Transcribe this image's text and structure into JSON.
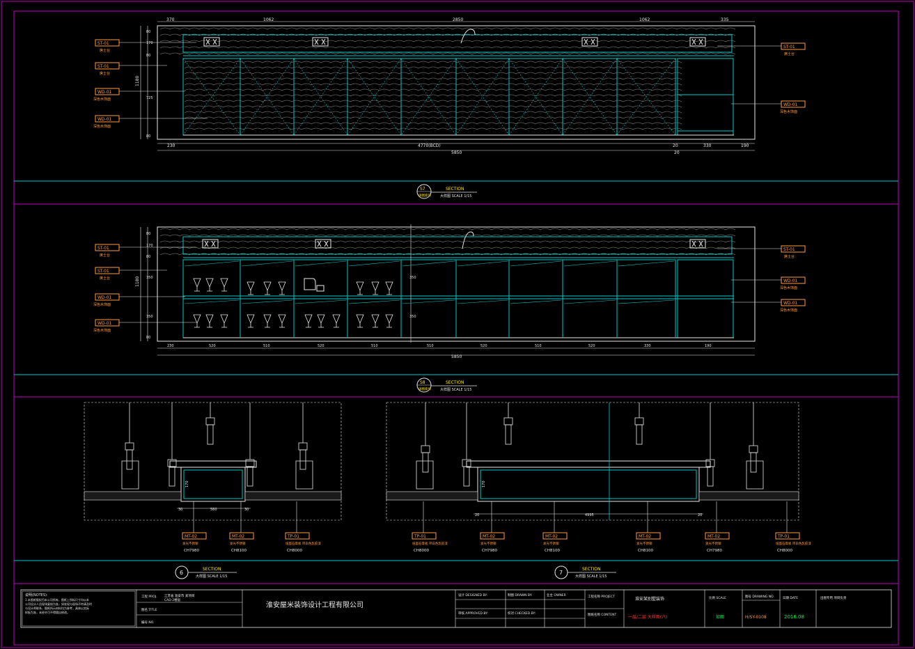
{
  "colors": {
    "frame": "#c000c0",
    "teal": "#00c8c8",
    "white": "#e8e8e8",
    "orange": "#ff9a3c",
    "yellow": "#ffe600",
    "green": "#00ff40",
    "grey": "#a0a0a0"
  },
  "s7": {
    "tag_top": "S7",
    "tag_bottom": "详图索引",
    "title": "SECTION",
    "scale": "大样图 SCALE 1/15",
    "top_dims": [
      "370",
      "1062",
      "2850",
      "1062",
      "335"
    ],
    "bottom_dims": [
      "230",
      "4770(BCD)",
      "20",
      "330",
      "190"
    ],
    "total": "5850",
    "total_right": "20",
    "left_dims": [
      "80",
      "170",
      "80",
      "725",
      "80"
    ],
    "height": "1180",
    "tags_left": [
      {
        "code": "ST-01",
        "desc": "席士台"
      },
      {
        "code": "ST-01",
        "desc": "席士台"
      },
      {
        "code": "WD-01",
        "desc": "深色木饰面"
      },
      {
        "code": "WD-01",
        "desc": "深色木饰面"
      }
    ],
    "tags_right": [
      {
        "code": "ST-01",
        "desc": "席士台"
      },
      {
        "code": "WD-01",
        "desc": "深色木饰面"
      }
    ]
  },
  "s8": {
    "tag_top": "S8",
    "tag_bottom": "详图索引",
    "title": "SECTION",
    "scale": "大样图 SCALE 1/15",
    "bottom_dims": [
      "230",
      "520",
      "510",
      "520",
      "510",
      "510",
      "520",
      "510",
      "520",
      "330",
      "190"
    ],
    "total": "5850",
    "left_dims": [
      "80",
      "170",
      "80",
      "350",
      "350",
      "80"
    ],
    "height": "1180",
    "mid_dims": [
      "350",
      "350"
    ],
    "tags_left": [
      {
        "code": "ST-01",
        "desc": "席士台"
      },
      {
        "code": "ST-01",
        "desc": "席士台"
      },
      {
        "code": "WD-01",
        "desc": "深色木饰面"
      },
      {
        "code": "WD-01",
        "desc": "深色木饰面"
      }
    ],
    "tags_right": [
      {
        "code": "ST-01",
        "desc": "席士台"
      },
      {
        "code": "WD-01",
        "desc": "深色木饰面"
      },
      {
        "code": "WD-01",
        "desc": "深色木饰面"
      }
    ]
  },
  "sec6": {
    "num": "6",
    "title": "SECTION",
    "scale": "大样图 SCALE 1/15",
    "dims": [
      "30",
      "560",
      "30"
    ],
    "vdim": "170",
    "tags": [
      {
        "code": "MT-02",
        "desc": "发光不锈钢",
        "model": "CH7980"
      },
      {
        "code": "MT-02",
        "desc": "发光不锈钢",
        "model": "CH8100"
      },
      {
        "code": "TP-01",
        "desc": "纸面石膏板 带白色乳胶漆",
        "model": "CH8000"
      }
    ]
  },
  "sec7": {
    "num": "7",
    "title": "SECTION",
    "scale": "大样图 SCALE 1/15",
    "dims": [
      "20",
      "4995",
      "20"
    ],
    "vdim": "170",
    "tags": [
      {
        "code": "TP-01",
        "desc": "纸面石膏板 带白色乳胶漆",
        "model": "CH8000"
      },
      {
        "code": "MT-02",
        "desc": "发光不锈钢",
        "model": "CH7980"
      },
      {
        "code": "MT-02",
        "desc": "发光不锈钢",
        "model": "CH8100"
      },
      {
        "code": "MT-02",
        "desc": "发光不锈钢",
        "model": "CH8100"
      },
      {
        "code": "MT-02",
        "desc": "发光不锈钢",
        "model": "CH7980"
      },
      {
        "code": "TP-01",
        "desc": "纸面石膏板 带白色乳胶漆",
        "model": "CH8000"
      }
    ]
  },
  "title_block": {
    "notes_head": "说明(NOTES):",
    "notes_lines": [
      "1.本图纸版权归本公司所有，图纸上所标尺寸均以本",
      "  公司设计人员现场复核为准，如发现与现场不符请及时",
      "  与设计师联系，图纸所示材料均为参考，具体以实际",
      "  样板为准，未经许可不得擅自修改。"
    ],
    "project_label": "工程 PROJ.",
    "project_value": "江苏省 淮安市 某项目",
    "project_sub": "CAD-2楼层",
    "drawing_label": "图名 TITLE",
    "no_label": "编号 NO.",
    "company": "淮安屋米装饰设计工程有限公司",
    "designed": "设计 DESIGNED BY:",
    "drawn": "制图 DRAWN BY:",
    "owner": "业主 OWNER",
    "approved": "审核 APPROVED BY:",
    "checked": "校对 CHECKED BY:",
    "project2": "工程名称 PROJECT",
    "content": "图纸名称 CONTENT",
    "name_value": "淮安某别墅装饰",
    "content_value": "一层/二层 大样图(六)",
    "scale_label": "比例 SCALE",
    "scale_value": "如图",
    "dwg_label": "图号 DRAWING NO.",
    "dwg_value": "H/SY-0108",
    "date_label": "日期 DATE",
    "date_value": "2016.08",
    "seal_label": "出图专用 项目负责"
  }
}
